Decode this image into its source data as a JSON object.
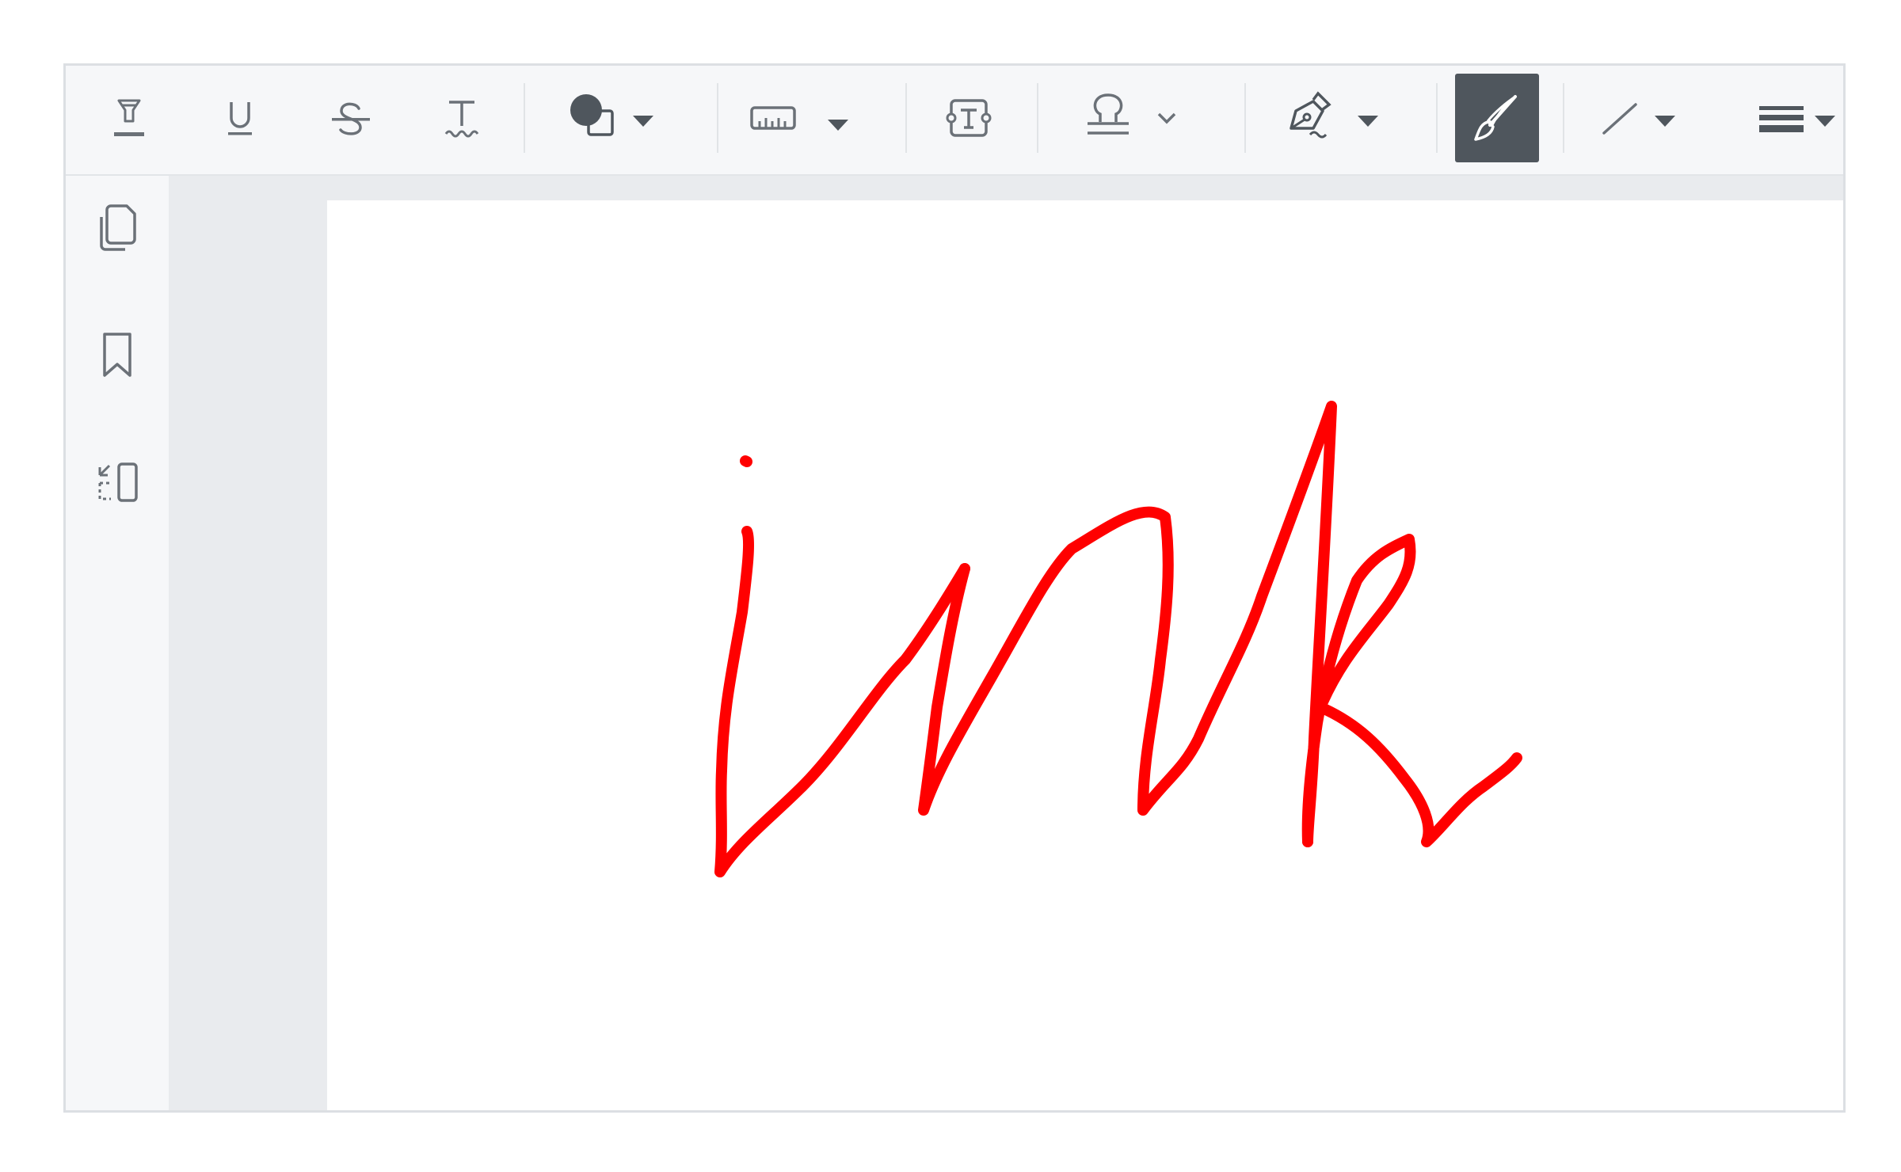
{
  "toolbar": {
    "tools": [
      {
        "name": "highlight-tool",
        "icon": "highlight-icon"
      },
      {
        "name": "underline-tool",
        "icon": "underline-icon"
      },
      {
        "name": "strikeout-tool",
        "icon": "strikeout-icon"
      },
      {
        "name": "squiggly-tool",
        "icon": "squiggly-icon"
      },
      {
        "name": "shape-tool",
        "icon": "shape-icon",
        "dropdown": true
      },
      {
        "name": "measure-tool",
        "icon": "ruler-icon",
        "dropdown": true
      },
      {
        "name": "freetext-tool",
        "icon": "textbox-icon"
      },
      {
        "name": "stamp-tool",
        "icon": "stamp-icon",
        "dropdown": true
      },
      {
        "name": "signature-tool",
        "icon": "pen-signature-icon",
        "dropdown": true
      },
      {
        "name": "ink-tool",
        "icon": "brush-icon",
        "active": true
      },
      {
        "name": "line-tool",
        "icon": "line-icon",
        "dropdown": true
      },
      {
        "name": "line-thickness-tool",
        "icon": "line-thickness-icon",
        "dropdown": true
      }
    ]
  },
  "sidebar": {
    "items": [
      {
        "name": "pages-thumbnails",
        "icon": "pages-icon"
      },
      {
        "name": "bookmarks",
        "icon": "bookmark-icon"
      },
      {
        "name": "outline-panel",
        "icon": "outline-icon"
      }
    ]
  },
  "annotation": {
    "type": "ink",
    "handwritten_text": "ink",
    "color": "#ff0000"
  },
  "colors": {
    "toolbar_bg": "#f6f7f9",
    "active_tool_bg": "#4f565d",
    "icon_gray": "#6b7178",
    "ink_red": "#ff0000"
  }
}
